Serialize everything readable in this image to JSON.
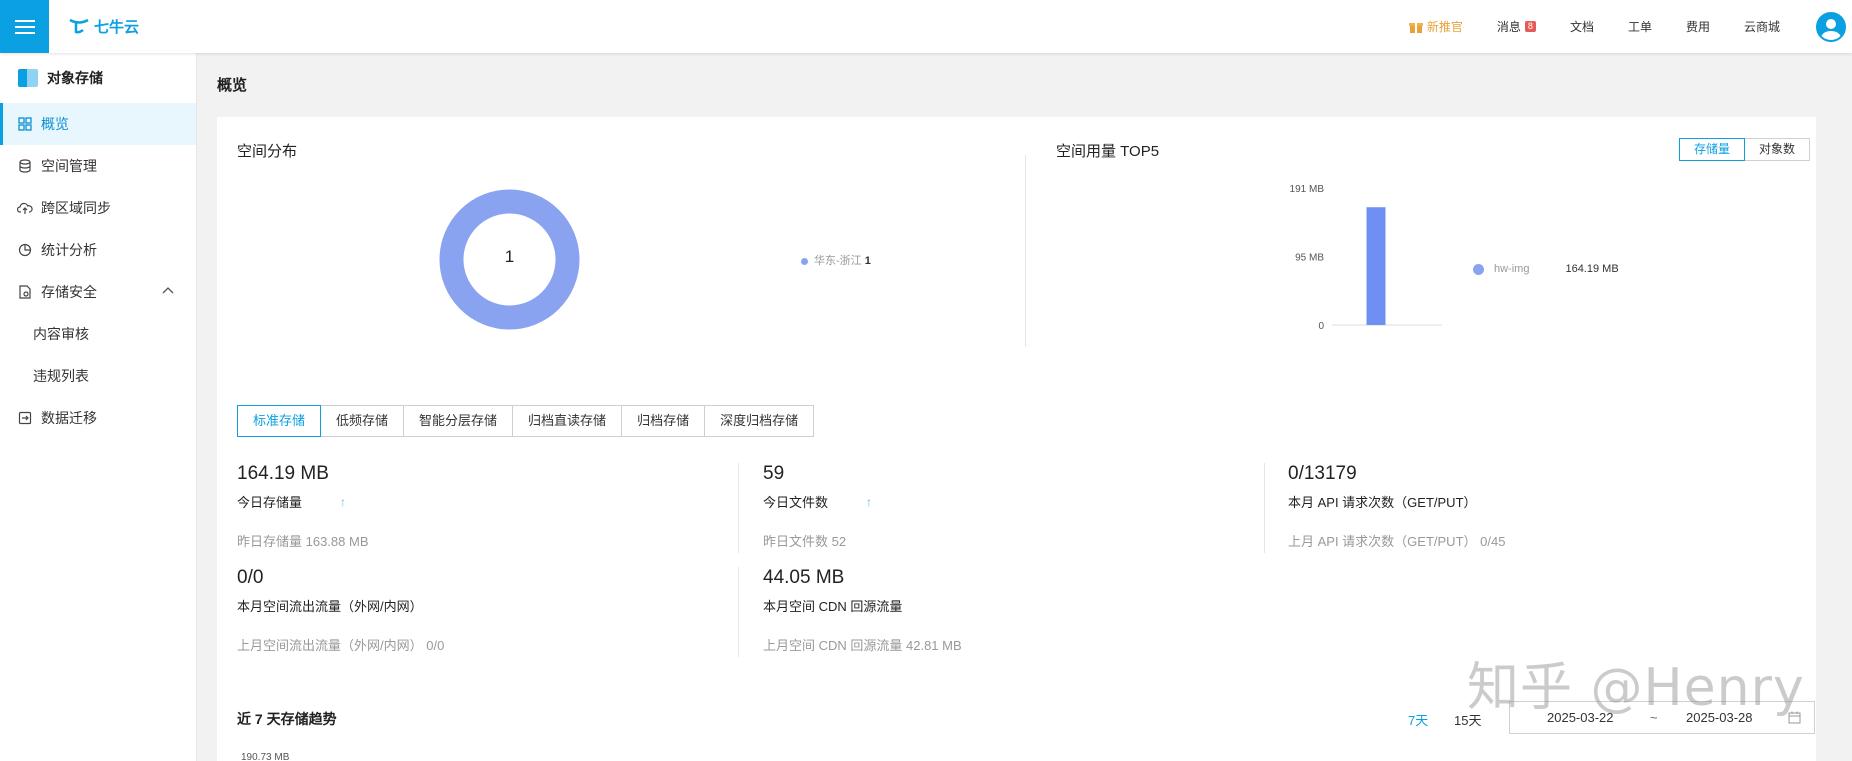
{
  "topbar": {
    "brand": "七牛云",
    "nav": {
      "promo": "新推官",
      "messages": "消息",
      "messages_badge": "8",
      "docs": "文档",
      "tickets": "工单",
      "billing": "费用",
      "marketplace": "云商城"
    }
  },
  "sidebar": {
    "product": "对象存储",
    "items": {
      "overview": "概览",
      "buckets": "空间管理",
      "cross_region": "跨区域同步",
      "analytics": "统计分析",
      "security": "存储安全",
      "content_review": "内容审核",
      "violations": "违规列表",
      "migration": "数据迁移"
    }
  },
  "page": {
    "title": "概览"
  },
  "distribution": {
    "title": "空间分布",
    "center_value": "1",
    "legend_region": "华东-浙江",
    "legend_value": "1",
    "ring_color": "#8aa3f0"
  },
  "top5": {
    "title": "空间用量 TOP5",
    "toggle_storage": "存储量",
    "toggle_objects": "对象数",
    "chart_data": {
      "type": "bar",
      "categories": [
        "hw-img"
      ],
      "values": [
        164.19
      ],
      "yticks": [
        "191 MB",
        "95 MB",
        "0"
      ],
      "ylim": [
        0,
        191
      ],
      "legend": [
        {
          "name": "hw-img",
          "value": "164.19 MB"
        }
      ],
      "color": "#6f8ff2"
    }
  },
  "storage_tabs": [
    "标准存储",
    "低频存储",
    "智能分层存储",
    "归档直读存储",
    "归档存储",
    "深度归档存储"
  ],
  "stats": {
    "storage": {
      "value": "164.19 MB",
      "label": "今日存储量",
      "prev": "昨日存储量 163.88 MB"
    },
    "files": {
      "value": "59",
      "label": "今日文件数",
      "prev": "昨日文件数 52"
    },
    "api": {
      "value": "0/13179",
      "label": "本月 API 请求次数（GET/PUT）",
      "prev": "上月 API 请求次数（GET/PUT） 0/45"
    },
    "outbound": {
      "value": "0/0",
      "label": "本月空间流出流量（外网/内网）",
      "prev": "上月空间流出流量（外网/内网） 0/0"
    },
    "cdn": {
      "value": "44.05 MB",
      "label": "本月空间 CDN 回源流量",
      "prev": "上月空间 CDN 回源流量 42.81 MB"
    }
  },
  "trend": {
    "title": "近 7 天存储趋势",
    "range_7": "7天",
    "range_15": "15天",
    "date_start": "2025-03-22",
    "date_sep": "~",
    "date_end": "2025-03-28",
    "ymax_label": "190.73 MB"
  },
  "watermark": "知乎 @Henry"
}
